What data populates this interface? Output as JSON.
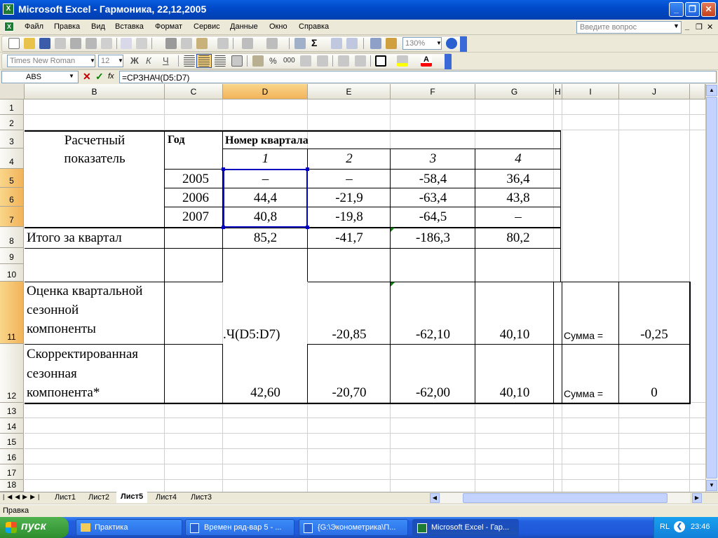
{
  "window": {
    "title": "Microsoft Excel - Гармоника, 22,12,2005",
    "buttons": [
      "_",
      "❐",
      "✕"
    ]
  },
  "menu": {
    "items": [
      "Файл",
      "Правка",
      "Вид",
      "Вставка",
      "Формат",
      "Сервис",
      "Данные",
      "Окно",
      "Справка"
    ],
    "ask_placeholder": "Введите вопрос",
    "doc_buttons": [
      "_",
      "❐",
      "✕"
    ]
  },
  "toolbar": {
    "zoom": "130%",
    "sigma": "Σ"
  },
  "format_toolbar": {
    "font": "Times New Roman",
    "size": "12",
    "bold": "Ж",
    "italic": "К",
    "underline": "Ч",
    "percent": "%",
    "thousands": "000"
  },
  "formula_bar": {
    "name_box": "ABS",
    "cancel": "✕",
    "enter": "✓",
    "fx": "fx",
    "formula": "=СРЗНАЧ(D5:D7)"
  },
  "columns": [
    "B",
    "C",
    "D",
    "E",
    "F",
    "G",
    "H",
    "I",
    "J"
  ],
  "rows": [
    "1",
    "2",
    "3",
    "4",
    "5",
    "6",
    "7",
    "8",
    "9",
    "10",
    "11",
    "12",
    "13",
    "14",
    "15",
    "16",
    "17",
    "18"
  ],
  "table": {
    "indicator_header": [
      "Расчетный",
      "показатель"
    ],
    "year_header": "Год",
    "quarter_header": "Номер квартала",
    "quarters": [
      "1",
      "2",
      "3",
      "4"
    ],
    "years": [
      "2005",
      "2006",
      "2007"
    ],
    "data": [
      [
        "–",
        "–",
        "-58,4",
        "36,4"
      ],
      [
        "44,4",
        "-21,9",
        "-63,4",
        "43,8"
      ],
      [
        "40,8",
        "-19,8",
        "-64,5",
        "–"
      ]
    ],
    "total_label": "Итого за квартал",
    "totals": [
      "85,2",
      "-41,7",
      "-186,3",
      "80,2"
    ],
    "seasonal_label": [
      "Оценка квартальной",
      "сезонной",
      "компоненты"
    ],
    "seasonal_edit": ".Ч(D5:D7)",
    "seasonal": [
      "-20,85",
      "-62,10",
      "40,10"
    ],
    "seasonal_sum_label": "Сумма =",
    "seasonal_sum": "-0,25",
    "adjusted_label": [
      "Скорректированная",
      "сезонная",
      "компонента*"
    ],
    "adjusted": [
      "42,60",
      "-20,70",
      "-62,00",
      "40,10"
    ],
    "adjusted_sum_label": "Сумма =",
    "adjusted_sum": "0"
  },
  "sheet_tabs": [
    "Лист1",
    "Лист2",
    "Лист5",
    "Лист4",
    "Лист3"
  ],
  "active_sheet": "Лист5",
  "status": "Правка",
  "taskbar": {
    "start": "пуск",
    "tasks": [
      "Практика",
      "Времен ряд-вар 5 - ...",
      "{G:\\Эконометрика\\П...",
      "Microsoft Excel - Гар..."
    ],
    "lang": "RL",
    "time": "23:46"
  },
  "colors": {
    "title_blue": "#0a5ee0",
    "selection_blue": "#0000c0",
    "header_selected": "#f2b35a",
    "taskbar_green": "#2e8e2e"
  }
}
